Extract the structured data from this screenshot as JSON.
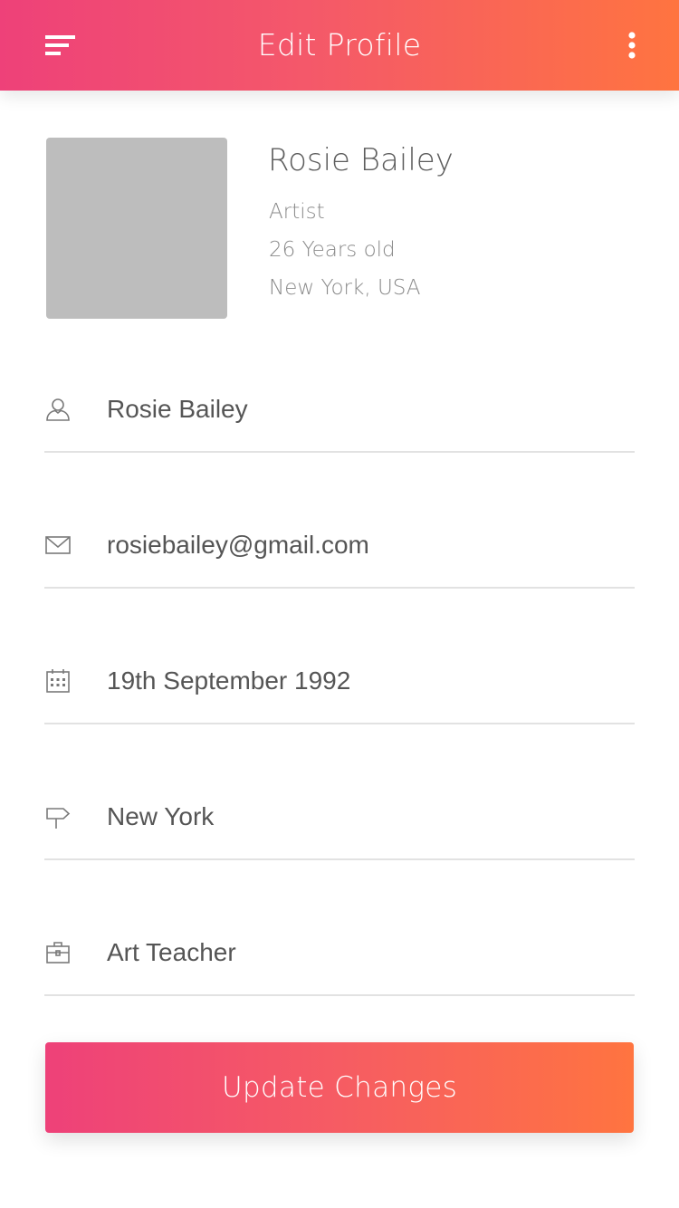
{
  "app_bar": {
    "title": "Edit Profile",
    "left_icon": "menu-icon",
    "right_icon": "more-vertical-icon",
    "gradient_start": "#ee4179",
    "gradient_end": "#ff7440"
  },
  "profile": {
    "name": "Rosie Bailey",
    "occupation": "Artist",
    "age": "26 Years old",
    "location": "New York, USA"
  },
  "fields": [
    {
      "icon": "user-icon",
      "value": "Rosie Bailey"
    },
    {
      "icon": "mail-icon",
      "value": "rosiebailey@gmail.com"
    },
    {
      "icon": "calendar-icon",
      "value": "19th September 1992"
    },
    {
      "icon": "signpost-icon",
      "value": "New York"
    },
    {
      "icon": "briefcase-icon",
      "value": "Art Teacher"
    }
  ],
  "actions": {
    "update_label": "Update Changes"
  }
}
